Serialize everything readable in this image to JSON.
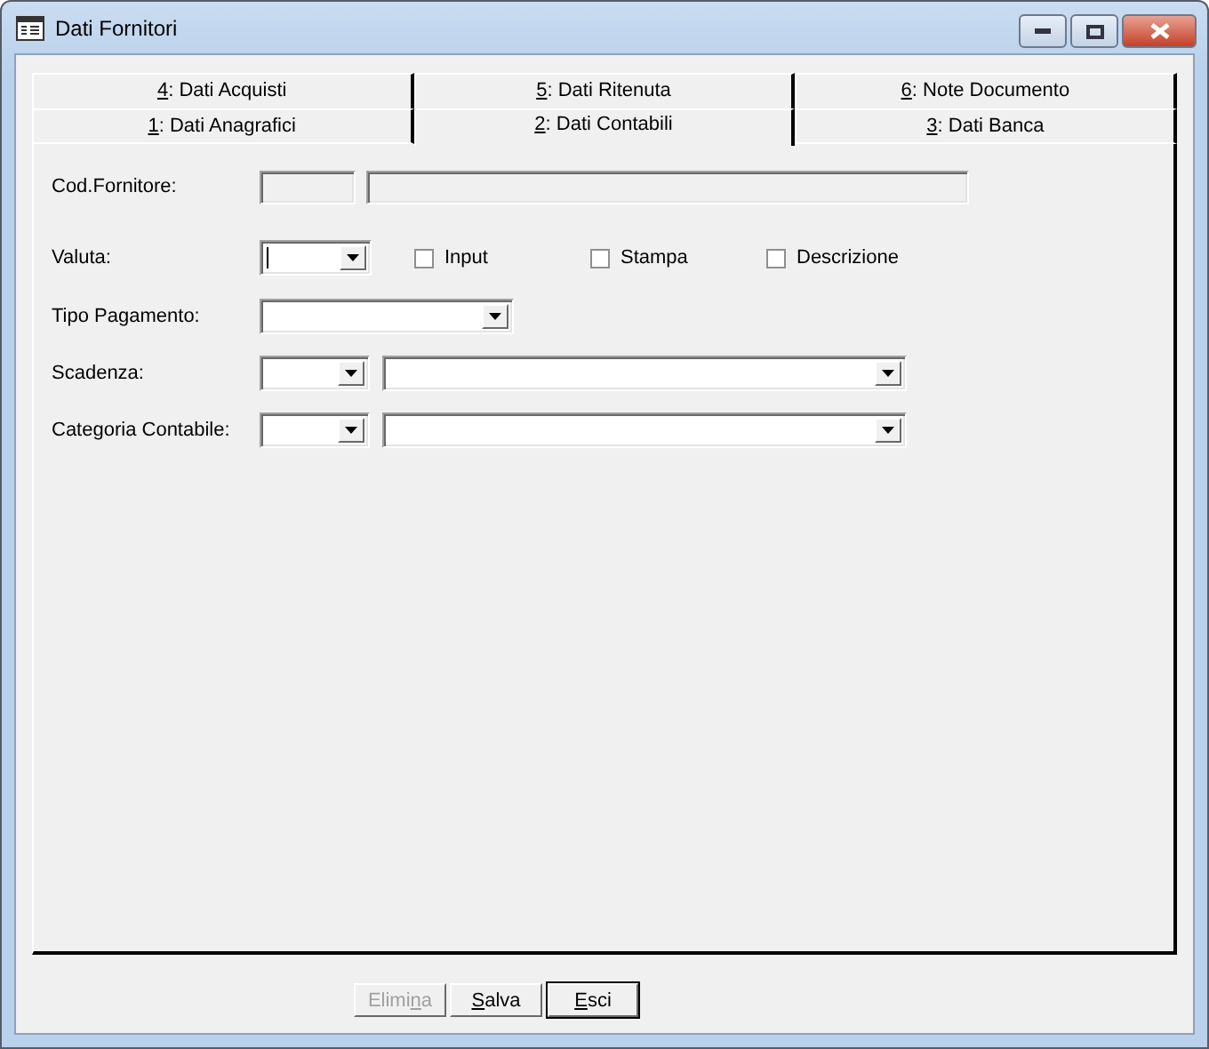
{
  "window": {
    "title": "Dati Fornitori"
  },
  "tab_rows": [
    {
      "tabs": [
        {
          "key": "4",
          "post": ": Dati Acquisti",
          "selected": false
        },
        {
          "key": "5",
          "post": ": Dati Ritenuta",
          "selected": false
        },
        {
          "key": "6",
          "post": ": Note Documento",
          "selected": false
        }
      ]
    },
    {
      "tabs": [
        {
          "key": "1",
          "post": ": Dati Anagrafici",
          "selected": false
        },
        {
          "key": "2",
          "post": ": Dati Contabili",
          "selected": true
        },
        {
          "key": "3",
          "post": ": Dati Banca",
          "selected": false
        }
      ]
    }
  ],
  "form_rows": [
    {
      "label": "Cod.Fornitore:",
      "controls": [
        {
          "kind": "textbox",
          "disabled": true
        },
        {
          "kind": "textbox",
          "disabled": true
        }
      ]
    },
    {
      "label": "Valuta:",
      "controls": [
        {
          "kind": "combo",
          "focused": true
        },
        {
          "kind": "checkbox",
          "label": "Input",
          "checked": false
        },
        {
          "kind": "checkbox",
          "label": "Stampa",
          "checked": false
        },
        {
          "kind": "checkbox",
          "label": "Descrizione",
          "checked": false
        }
      ]
    },
    {
      "label": "Tipo Pagamento:",
      "controls": [
        {
          "kind": "combo",
          "focused": false
        }
      ]
    },
    {
      "label": "Scadenza:",
      "controls": [
        {
          "kind": "combo",
          "focused": false
        },
        {
          "kind": "combo",
          "focused": false
        }
      ]
    },
    {
      "label": "Categoria Contabile:",
      "controls": [
        {
          "kind": "combo",
          "focused": false
        },
        {
          "kind": "combo",
          "focused": false
        }
      ]
    }
  ],
  "buttons": [
    {
      "pre": "Elimi",
      "key": "n",
      "post": "a",
      "disabled": true,
      "default": false
    },
    {
      "key": "S",
      "post": "alva",
      "disabled": false,
      "default": false
    },
    {
      "key": "E",
      "post": "sci",
      "disabled": false,
      "default": true
    }
  ]
}
